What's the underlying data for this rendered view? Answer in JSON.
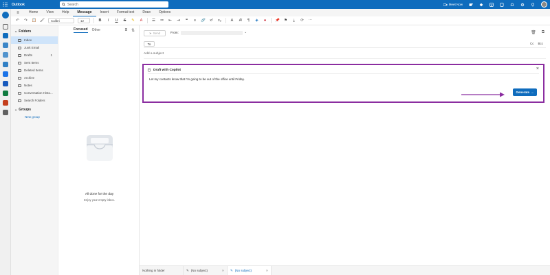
{
  "app": {
    "title": "Outlook"
  },
  "search": {
    "placeholder": "Search"
  },
  "titlebar": {
    "meet_now": "Meet Now"
  },
  "menu": {
    "tabs": [
      "Home",
      "View",
      "Help",
      "Message",
      "Insert",
      "Format text",
      "Draw",
      "Options"
    ],
    "active": "Message"
  },
  "ribbon": {
    "font": "Calibri",
    "size": "12"
  },
  "folders": {
    "header": "Folders",
    "items": [
      {
        "label": "Inbox",
        "selected": true,
        "count": ""
      },
      {
        "label": "Junk Email",
        "count": ""
      },
      {
        "label": "Drafts",
        "count": "1"
      },
      {
        "label": "Sent Items",
        "count": ""
      },
      {
        "label": "Deleted Items",
        "count": ""
      },
      {
        "label": "Archive",
        "count": ""
      },
      {
        "label": "Notes",
        "count": ""
      },
      {
        "label": "Conversation Histo...",
        "count": ""
      },
      {
        "label": "Search Folders",
        "count": ""
      }
    ],
    "groups_header": "Groups",
    "new_group": "New group"
  },
  "message_list": {
    "tab_focused": "Focused",
    "tab_other": "Other",
    "empty_title": "All done for the day",
    "empty_subtitle": "Enjoy your empty inbox."
  },
  "compose": {
    "send": "Send",
    "from_label": "From:",
    "to_label": "To",
    "cc": "Cc",
    "bcc": "Bcc",
    "subject_placeholder": "Add a subject"
  },
  "copilot": {
    "title": "Draft with Copilot",
    "prompt": "Let my contacts know that I'm going to be out of the office until Friday.",
    "generate": "Generate"
  },
  "bottom_tabs": [
    {
      "label": "Nothing in folder",
      "active": false
    },
    {
      "label": "(No subject)",
      "active": false
    },
    {
      "label": "(No subject)",
      "active": true
    }
  ],
  "colors": {
    "accent": "#0f6cbd",
    "highlight": "#8b2da0",
    "selected_folder": "#cfe4fa"
  }
}
